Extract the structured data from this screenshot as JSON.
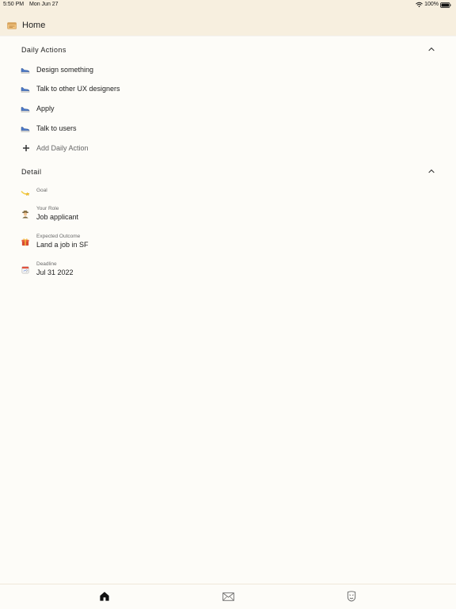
{
  "status": {
    "time": "5:50 PM",
    "date": "Mon Jun 27",
    "battery": "100%"
  },
  "nav": {
    "title": "Home"
  },
  "daily_actions": {
    "header": "Daily Actions",
    "items": [
      {
        "label": "Design something"
      },
      {
        "label": "Talk to other UX designers"
      },
      {
        "label": "Apply"
      },
      {
        "label": "Talk to users"
      }
    ],
    "add_label": "Add Daily Action"
  },
  "detail": {
    "header": "Detail",
    "goal_label": "Goal",
    "role_label": "Your Role",
    "role_value": "Job applicant",
    "outcome_label": "Expected Outcome",
    "outcome_value": "Land a job in SF",
    "deadline_label": "Deadline",
    "deadline_value": "Jul 31 2022"
  },
  "icons": {
    "nav": "calendar-icon",
    "daily_action": "running-shoe-icon",
    "add": "plus-icon",
    "goal": "shooting-star-icon",
    "role": "detective-icon",
    "outcome": "gift-icon",
    "deadline": "calendar-icon",
    "tabs": [
      "home-icon",
      "mail-icon",
      "mask-icon"
    ]
  },
  "colors": {
    "header_background": "#f7efdf",
    "page_background": "#fdfcf8",
    "text": "#222222",
    "muted_text": "#666666"
  }
}
